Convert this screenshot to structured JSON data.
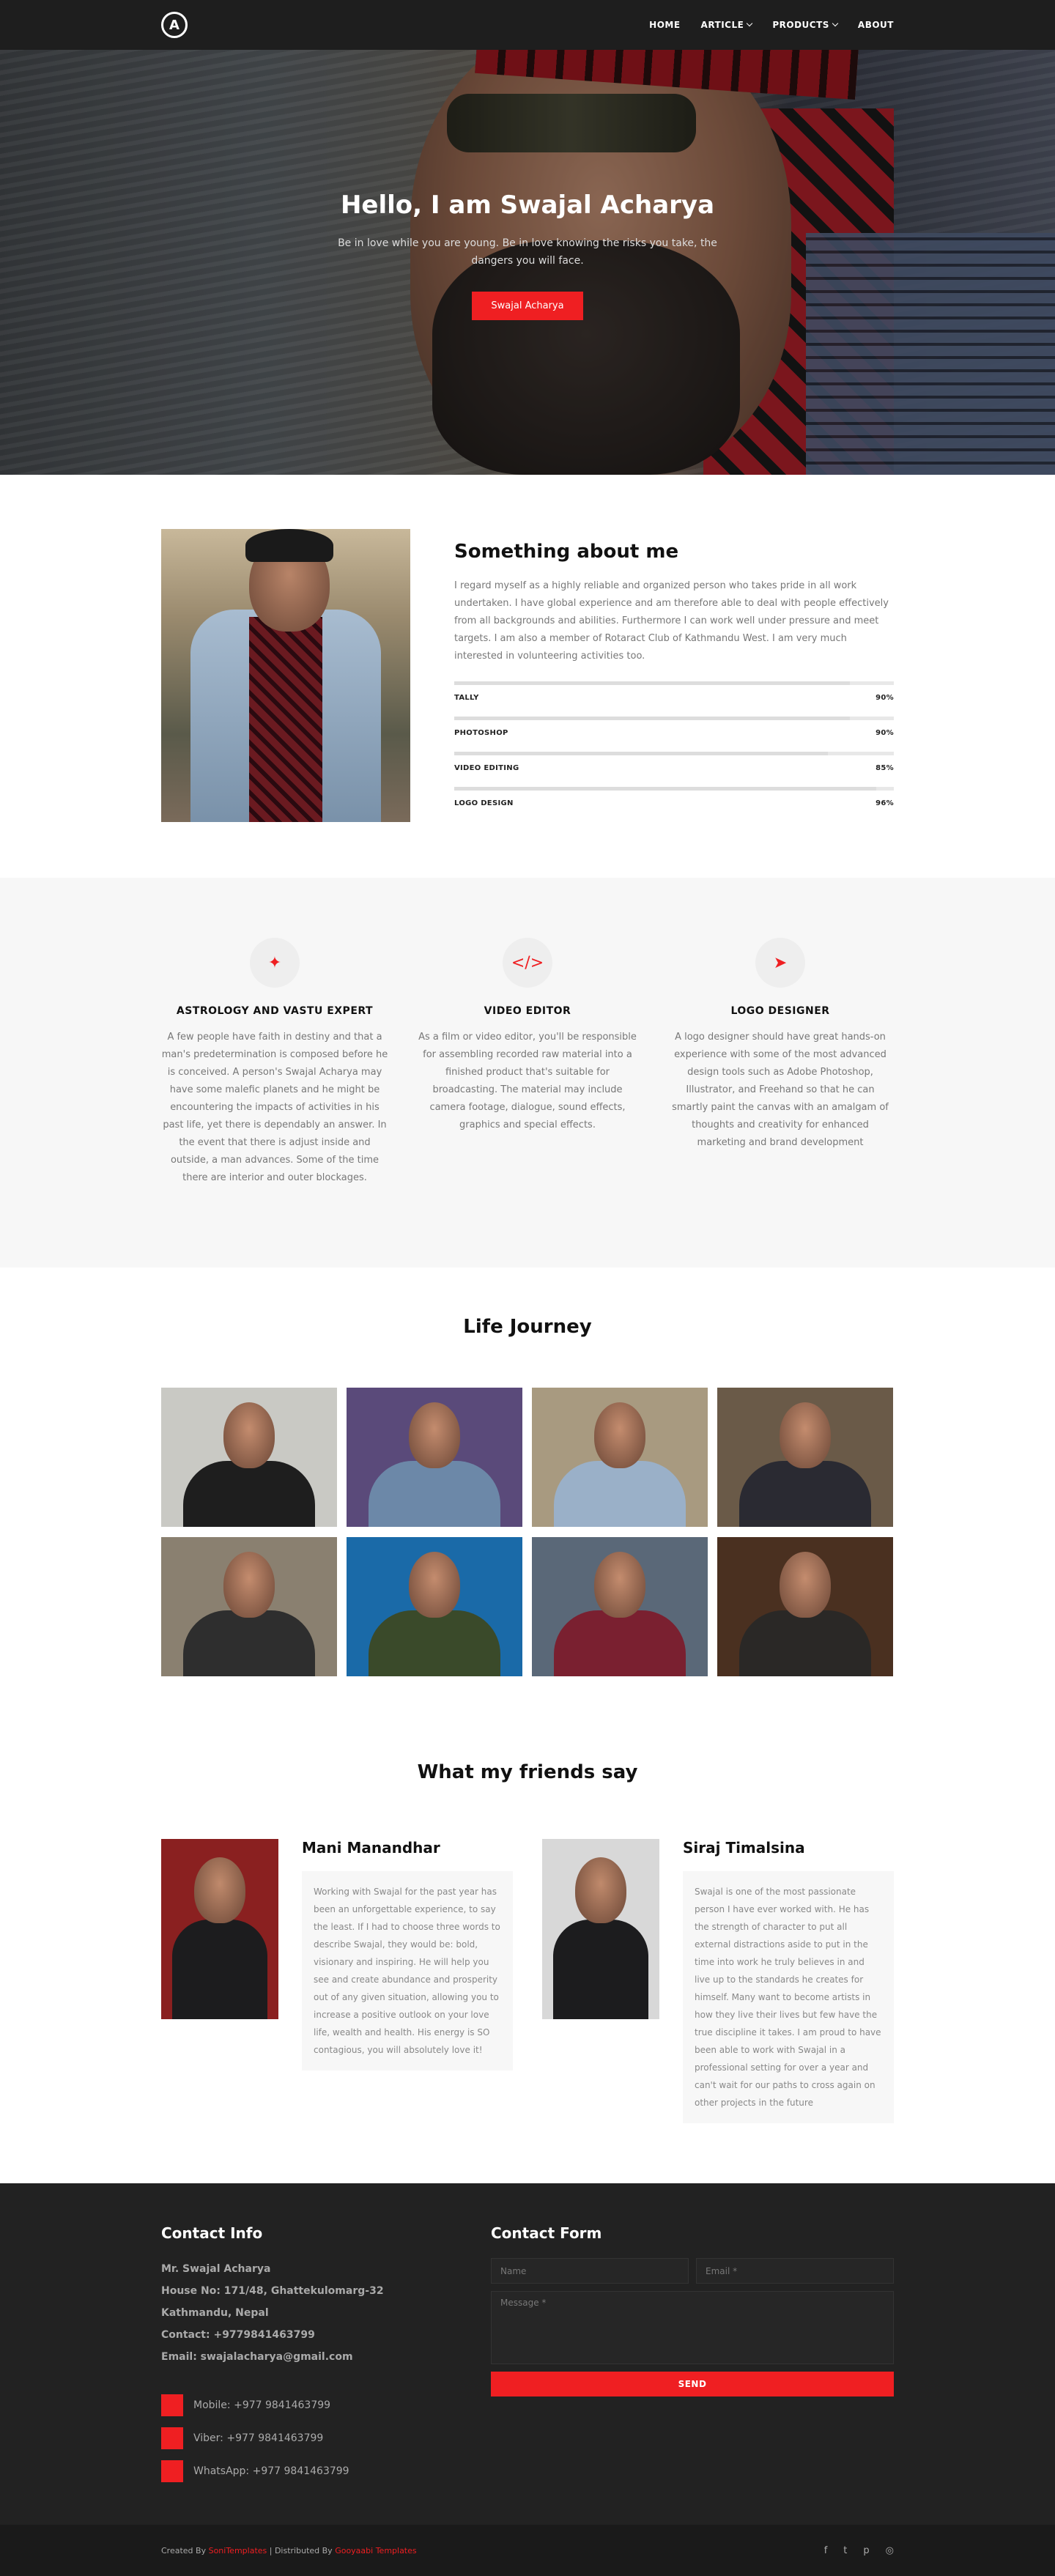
{
  "nav": {
    "logo": "A",
    "items": [
      {
        "label": "HOME",
        "dropdown": false
      },
      {
        "label": "ARTICLE",
        "dropdown": true
      },
      {
        "label": "PRODUCTS",
        "dropdown": true
      },
      {
        "label": "ABOUT",
        "dropdown": false
      }
    ]
  },
  "hero": {
    "title": "Hello, I am Swajal Acharya",
    "subtitle": "Be in love while you are young. Be in love knowing the risks you take, the dangers you will face.",
    "button": "Swajal Acharya"
  },
  "about": {
    "title": "Something about me",
    "text": "I regard myself as a highly reliable and organized person who takes pride in all work undertaken. I have global experience and am therefore able to deal with people effectively from all backgrounds and abilities. Furthermore I can work well under pressure and meet targets. I am also a member of Rotaract Club of Kathmandu West. I am very much interested in volunteering activities too.",
    "skills": [
      {
        "name": "TALLY",
        "percent": "90%",
        "value": 90
      },
      {
        "name": "PHOTOSHOP",
        "percent": "90%",
        "value": 90
      },
      {
        "name": "VIDEO EDITING",
        "percent": "85%",
        "value": 85
      },
      {
        "name": "LOGO DESIGN",
        "percent": "96%",
        "value": 96
      }
    ]
  },
  "services": [
    {
      "icon": "magic-wand-icon",
      "glyph": "✦",
      "title": "ASTROLOGY AND VASTU EXPERT",
      "text": "A few people have faith in destiny and that a man's predetermination is composed before he is conceived. A person's Swajal Acharya may have some malefic planets and he might be encountering the impacts of activities in his past life, yet there is dependably an answer. In the event that there is adjust inside and outside, a man advances. Some of the time there are interior and outer blockages."
    },
    {
      "icon": "code-icon",
      "glyph": "</>",
      "title": "VIDEO EDITOR",
      "text": "As a film or video editor, you'll be responsible for assembling recorded raw material into a finished product that's suitable for broadcasting. The material may include camera footage, dialogue, sound effects, graphics and special effects."
    },
    {
      "icon": "paper-plane-icon",
      "glyph": "➤",
      "title": "LOGO DESIGNER",
      "text": "A logo designer should have great hands-on experience with some of the most advanced design tools such as Adobe Photoshop, Illustrator, and Freehand so that he can smartly paint the canvas with an amalgam of thoughts and creativity for enhanced marketing and brand development"
    }
  ],
  "journey": {
    "title": "Life Journey",
    "photos": [
      {
        "bg": "#c9c9c4",
        "body": "#1e1e1e"
      },
      {
        "bg": "#5a4a7a",
        "body": "#6c88a8"
      },
      {
        "bg": "#a89a80",
        "body": "#9ab0c8"
      },
      {
        "bg": "#6a5a48",
        "body": "#2a2a32"
      },
      {
        "bg": "#8a8070",
        "body": "#2e2e2e"
      },
      {
        "bg": "#1a6aa8",
        "body": "#3a4a2a"
      },
      {
        "bg": "#5a6878",
        "body": "#7a2030"
      },
      {
        "bg": "#4a3020",
        "body": "#2a2826"
      }
    ]
  },
  "testimonials": {
    "title": "What my friends say",
    "items": [
      {
        "name": "Mani Manandhar",
        "bg": "#8a2020",
        "text": "Working with Swajal for the past year has been an unforgettable experience, to say the least. If I had to choose three words to describe Swajal, they would be: bold, visionary and inspiring. He will help you see and create abundance and prosperity out of any given situation, allowing you to increase a positive outlook on your love life, wealth and health. His energy is SO contagious, you will absolutely love it!"
      },
      {
        "name": "Siraj Timalsina",
        "bg": "#d8d8d8",
        "text": "Swajal is one of the most passionate person I have ever worked with. He has the strength of character to put all external distractions aside to put in the time into work he truly believes in and live up to the standards he creates for himself. Many want to become artists in how they live their lives but few have the true discipline it takes. I am proud to have been able to work with Swajal in a professional setting for over a year and can't wait for our paths to cross again on other projects in the future"
      }
    ]
  },
  "footer": {
    "contact_info_title": "Contact Info",
    "info": [
      "Mr. Swajal Acharya",
      "House No: 171/48, Ghattekulomarg-32",
      "Kathmandu, Nepal",
      "Contact: +9779841463799",
      "Email: swajalacharya@gmail.com"
    ],
    "social": [
      "Mobile: +977 9841463799",
      "Viber: +977 9841463799",
      "WhatsApp: +977 9841463799"
    ],
    "form_title": "Contact Form",
    "name_placeholder": "Name",
    "email_placeholder": "Email *",
    "message_placeholder": "Message *",
    "send": "SEND"
  },
  "bottom": {
    "created": "Created By",
    "created_link": "SoniTemplates",
    "sep": " | Distributed By",
    "dist_link": "Gooyaabi Templates",
    "icons": [
      "facebook-icon",
      "twitter-icon",
      "pinterest-icon",
      "instagram-icon"
    ],
    "glyphs": [
      "f",
      "t",
      "p",
      "◎"
    ]
  },
  "colors": {
    "accent": "#ef1f22",
    "dark": "#222222"
  }
}
